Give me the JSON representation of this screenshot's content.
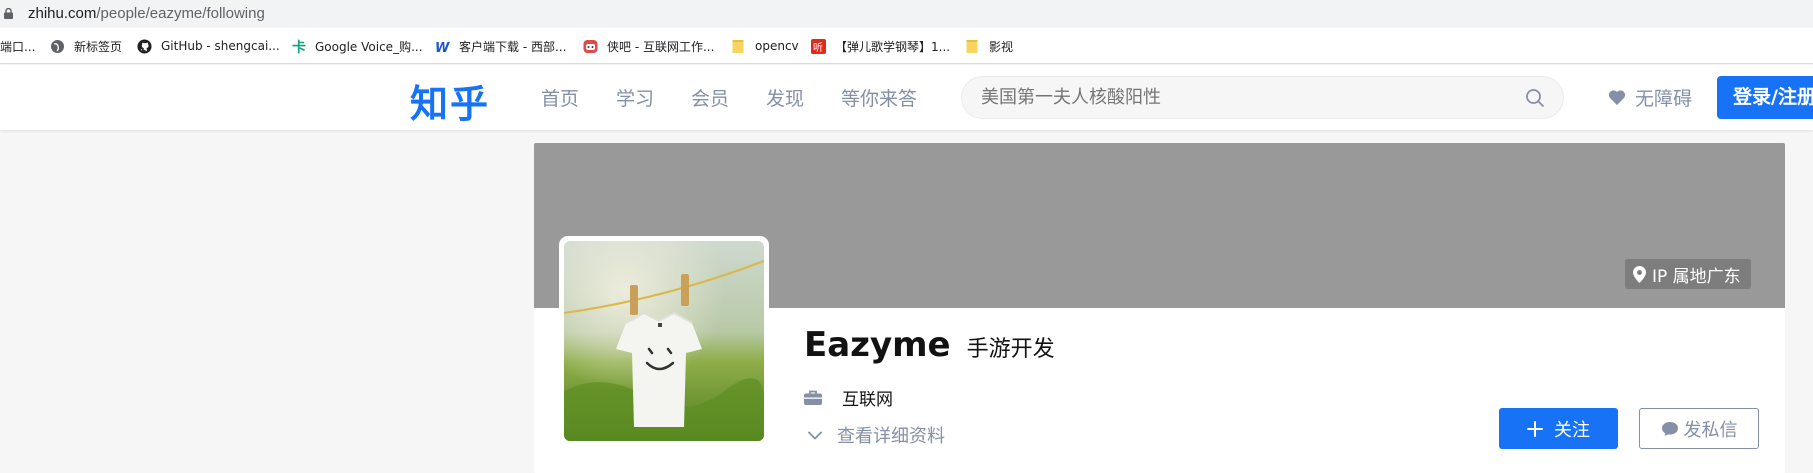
{
  "browser": {
    "url_host": "zhihu.com",
    "url_path": "/people/eazyme/following",
    "bookmarks": [
      {
        "label": "端口...",
        "icon": "generic-page-icon"
      },
      {
        "label": "新标签页",
        "icon": "globe-icon"
      },
      {
        "label": "GitHub - shengcai...",
        "icon": "github-icon"
      },
      {
        "label": "Google Voice_购...",
        "icon": "card-icon"
      },
      {
        "label": "客户端下载 - 西部...",
        "icon": "w-logo-icon"
      },
      {
        "label": "侠吧 - 互联网工作...",
        "icon": "xiaba-icon"
      },
      {
        "label": "opencv",
        "icon": "folder-icon"
      },
      {
        "label": "【弹儿歌学钢琴】1...",
        "icon": "ting-icon"
      },
      {
        "label": "影视",
        "icon": "folder-icon"
      }
    ]
  },
  "header": {
    "logo": "知乎",
    "nav": [
      "首页",
      "学习",
      "会员",
      "发现",
      "等你来答"
    ],
    "search_placeholder": "美国第一夫人核酸阳性",
    "accessibility_label": "无障碍",
    "login_label": "登录/注册",
    "brand_color": "#1772f6"
  },
  "profile": {
    "ip_location": "IP 属地广东",
    "name": "Eazyme",
    "headline": "手游开发",
    "industry": "互联网",
    "view_details": "查看详细资料",
    "follow_label": "关注",
    "message_label": "发私信",
    "cover_color": "#999999"
  }
}
